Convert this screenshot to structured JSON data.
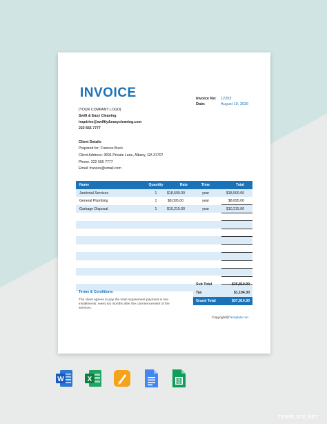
{
  "invoice": {
    "title": "INVOICE",
    "number_label": "Invoice No:",
    "number_value": "12203",
    "date_label": "Date:",
    "date_value": "August 10, 2030"
  },
  "company": {
    "logo": "[YOUR COMPANY LOGO]",
    "name": "Swift & Easy Cleaning",
    "email": "inquiries@swiftly&easycleaning.com",
    "phone": "222 555 7777"
  },
  "client": {
    "heading": "Client Details",
    "prepared": "Prepared for: Frances Bush",
    "address": "Client Address: 3691 Private Lane, Albany, GA 31707",
    "phone": "Phone: 222 555 7777",
    "email": "Email: frances@email.com"
  },
  "table": {
    "headers": [
      "Name",
      "Quantity",
      "Rate",
      "Time",
      "Total"
    ],
    "rows": [
      [
        "Janitorial Services",
        "1",
        "$18,500.00",
        "year",
        "$18,500.00"
      ],
      [
        "General Plumbing",
        "1",
        "$8,095.00",
        "year",
        "$8,095.00"
      ],
      [
        "Garbage Disposal",
        "1",
        "$10,215.00",
        "year",
        "$10,215.00"
      ]
    ]
  },
  "summary": {
    "subtotal_label": "Sub Total",
    "subtotal_value": "$36,810.00",
    "tax_label": "Tax",
    "tax_value": "$1,104.30",
    "grand_label": "Grand Total",
    "grand_value": "$37,914.30"
  },
  "terms": {
    "title": "Terms & Conditions:",
    "body": "The client agrees to pay the total requirement payment in two installments: every six months after the commencement of the services."
  },
  "copyright": {
    "prefix": "Copyright@",
    "link": "Template.net"
  },
  "apps": [
    "word-icon",
    "excel-icon",
    "pages-icon",
    "google-docs-icon",
    "google-sheets-icon"
  ],
  "watermark": "TEMPLATE.NET",
  "colors": {
    "accent": "#1a72b8",
    "row_tint": "#dcebf8"
  }
}
